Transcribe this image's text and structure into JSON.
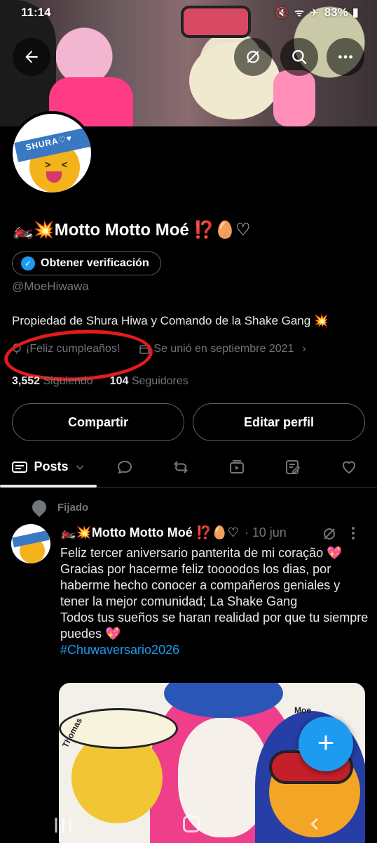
{
  "status_bar": {
    "time": "11:14",
    "battery": "83%"
  },
  "profile": {
    "name": "🏍️💥Motto Motto Moé ⁉️🥚♡",
    "verify_label": "Obtener verificación",
    "handle": "@MoeHiwawa",
    "bio": "Propiedad de Shura Hiwa y Comando de la Shake Gang 💥",
    "birthday": "¡Feliz cumpleaños!",
    "joined": "Se unió en septiembre 2021",
    "following_count": "3,552",
    "following_label": "Siguiendo",
    "followers_count": "104",
    "followers_label": "Seguidores",
    "avatar_banner_text": "SHURA♡♥"
  },
  "buttons": {
    "share": "Compartir",
    "edit": "Editar perfil"
  },
  "tabs": {
    "posts": "Posts"
  },
  "tweet": {
    "pinned_label": "Fijado",
    "author": "🏍️💥Motto Motto Moé ⁉️🥚♡",
    "date": "· 10 jun",
    "line1": "Feliz tercer aniversario panterita de mi coração 💖",
    "line2": "Gracias por hacerme feliz toooodos los dias, por haberme hecho conocer a compañeros geniales y tener la mejor comunidad; La Shake Gang",
    "line3": "Todos tus sueños se haran realidad por que tu siempre puedes 💖",
    "hashtag": "#Chuwaversario2026",
    "image_label_left": "Thomas",
    "image_label_right": "Moe"
  },
  "colors": {
    "accent": "#1d9bf0",
    "background": "#000000",
    "annotation": "#e21b1b"
  },
  "icons": {
    "back": "arrow-left-icon",
    "grok": "grok-icon",
    "search": "search-icon",
    "more": "more-icon",
    "fab": "plus-icon"
  }
}
